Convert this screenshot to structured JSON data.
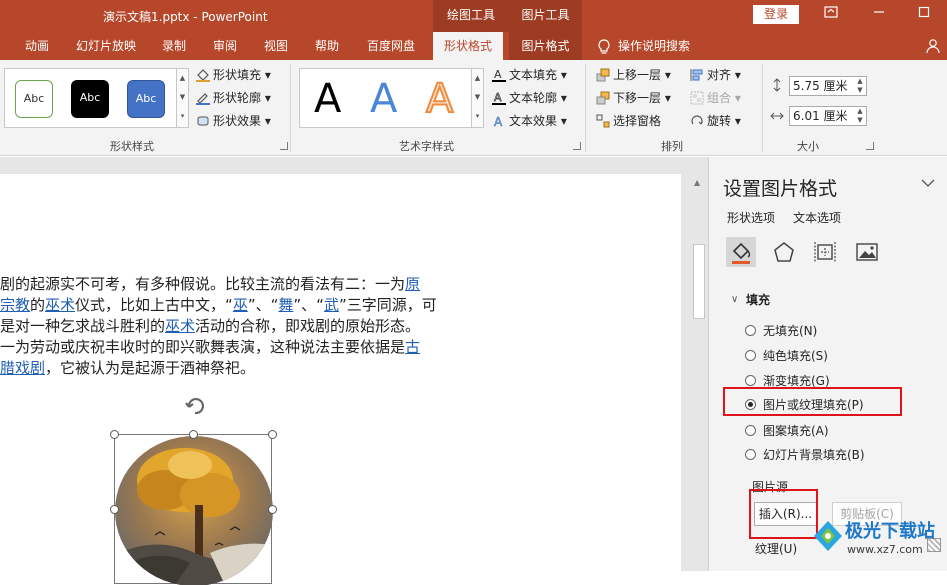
{
  "titlebar": {
    "doc_title": "演示文稿1.pptx  -  PowerPoint",
    "context_tab_drawing": "绘图工具",
    "context_tab_picture": "图片工具",
    "login": "登录"
  },
  "tabs": [
    "动画",
    "幻灯片放映",
    "录制",
    "审阅",
    "视图",
    "帮助",
    "百度网盘",
    "形状格式",
    "图片格式",
    "操作说明搜索"
  ],
  "ribbon": {
    "shape_styles": {
      "samples": [
        "Abc",
        "Abc",
        "Abc"
      ],
      "fill": "形状填充",
      "outline": "形状轮廓",
      "effects": "形状效果",
      "label": "形状样式"
    },
    "wordart": {
      "samples": [
        "A",
        "A",
        "A"
      ],
      "text_fill": "文本填充",
      "text_outline": "文本轮廓",
      "text_effects": "文本效果",
      "label": "艺术字样式"
    },
    "arrange": {
      "bring_forward": "上移一层",
      "send_backward": "下移一层",
      "selection_pane": "选择窗格",
      "align": "对齐",
      "group": "组合",
      "rotate": "旋转",
      "label": "排列"
    },
    "size": {
      "height": "5.75 厘米",
      "width": "6.01 厘米",
      "label": "大小"
    }
  },
  "document": {
    "lines": [
      {
        "parts": [
          {
            "t": "剧的起源实不可考，有多种假说。比较主流的看法有二：一为",
            "link": false
          },
          {
            "t": "原",
            "link": true
          }
        ]
      },
      {
        "parts": [
          {
            "t": "宗教",
            "link": true
          },
          {
            "t": "的",
            "link": false
          },
          {
            "t": "巫术",
            "link": true
          },
          {
            "t": "仪式，比如上古中文，“",
            "link": false
          },
          {
            "t": "巫",
            "link": true
          },
          {
            "t": "”、“",
            "link": false
          },
          {
            "t": "舞",
            "link": true
          },
          {
            "t": "”、“",
            "link": false
          },
          {
            "t": "武",
            "link": true
          },
          {
            "t": "”三字同源，可",
            "link": false
          }
        ]
      },
      {
        "parts": [
          {
            "t": "是对一种乞求战斗胜利的",
            "link": false
          },
          {
            "t": "巫术",
            "link": true
          },
          {
            "t": "活动的合称，即戏剧的原始形态。",
            "link": false
          }
        ]
      },
      {
        "parts": [
          {
            "t": "一为劳动或庆祝丰收时的即兴歌舞表演，这种说法主要依据是",
            "link": false
          },
          {
            "t": "古",
            "link": true
          }
        ]
      },
      {
        "parts": [
          {
            "t": "腊戏剧",
            "link": true
          },
          {
            "t": "，它被认为是起源于酒神祭祀。",
            "link": false
          }
        ]
      }
    ]
  },
  "pane": {
    "title": "设置图片格式",
    "tab_shape": "形状选项",
    "tab_text": "文本选项",
    "section_fill": "填充",
    "options": [
      {
        "label": "无填充(N)",
        "checked": false
      },
      {
        "label": "纯色填充(S)",
        "checked": false
      },
      {
        "label": "渐变填充(G)",
        "checked": false
      },
      {
        "label": "图片或纹理填充(P)",
        "checked": true
      },
      {
        "label": "图案填充(A)",
        "checked": false
      },
      {
        "label": "幻灯片背景填充(B)",
        "checked": false
      }
    ],
    "picture_source": "图片源",
    "insert": "插入(R)...",
    "clipboard": "剪贴板(C)",
    "texture": "纹理(U)"
  },
  "watermark": {
    "name": "极光下载站",
    "url": "www.xz7.com"
  },
  "colors": {
    "accent": "#b7472a",
    "accent_dark": "#9d3c23",
    "link": "#1f5fb4",
    "highlight": "#e0131b"
  }
}
